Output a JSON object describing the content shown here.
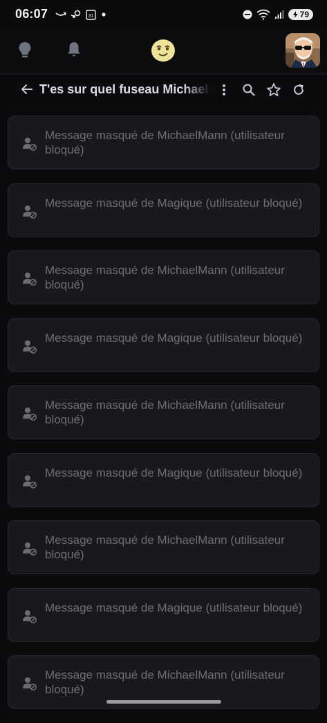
{
  "status_bar": {
    "time": "06:07",
    "battery": "79",
    "left_icons": [
      "amazon-icon",
      "steam-icon",
      "calendar-icon",
      "dot-icon"
    ],
    "right_icons": [
      "dnd-icon",
      "wifi-icon",
      "signal-icon",
      "battery-icon"
    ]
  },
  "app_bar": {
    "icons": [
      "lightbulb-icon",
      "bell-icon",
      "smiley-logo-icon",
      "avatar"
    ]
  },
  "thread": {
    "title": "T'es sur quel fuseau MichaelMann",
    "actions": [
      "more-icon",
      "search-icon",
      "star-icon",
      "refresh-icon"
    ]
  },
  "messages": [
    {
      "text": "Message masqué de MichaelMann (utilisateur bloqué)"
    },
    {
      "text": "Message masqué de Magique (utilisateur bloqué)"
    },
    {
      "text": "Message masqué de MichaelMann (utilisateur bloqué)"
    },
    {
      "text": "Message masqué de Magique (utilisateur bloqué)"
    },
    {
      "text": "Message masqué de MichaelMann (utilisateur bloqué)"
    },
    {
      "text": "Message masqué de Magique (utilisateur bloqué)"
    },
    {
      "text": "Message masqué de MichaelMann (utilisateur bloqué)"
    },
    {
      "text": "Message masqué de Magique (utilisateur bloqué)"
    },
    {
      "text": "Message masqué de MichaelMann (utilisateur bloqué)"
    }
  ],
  "colors": {
    "background": "#0b0b0d",
    "card": "#18191d",
    "card_border": "#26272c",
    "muted_text": "#6d6e73",
    "title_text": "#d8dbe3",
    "logo_yellow": "#efe39a"
  }
}
